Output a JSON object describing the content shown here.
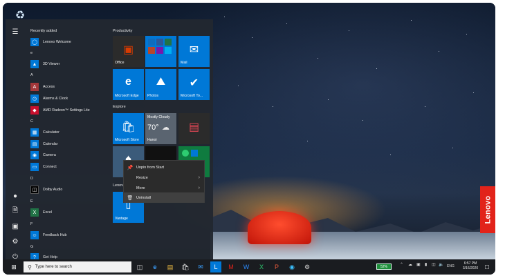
{
  "start_menu": {
    "recently_added_header": "Recently added",
    "sections": {
      "e": "e",
      "a": "A",
      "c": "C",
      "d": "D",
      "ee": "E",
      "f": "F",
      "g": "G"
    },
    "apps": {
      "lenovo_welcome": "Lenovo Welcome",
      "viewer_3d": "3D Viewer",
      "access": "Access",
      "alarms": "Alarms & Clock",
      "amd": "AMD Radeon™ Settings Lite",
      "calculator": "Calculator",
      "calendar": "Calendar",
      "camera": "Camera",
      "connect": "Connect",
      "dolby": "Dolby Audio",
      "excel": "Excel",
      "feedback": "Feedback Hub",
      "gethelp": "Get Help"
    },
    "groups": {
      "productivity": "Productivity",
      "explore": "Explore",
      "lenovo": "Lenov"
    },
    "tiles": {
      "office": "Office",
      "mail": "Mail",
      "edge": "Microsoft Edge",
      "photos": "Photos",
      "todo": "Microsoft To...",
      "store": "Microsoft Store",
      "weather_cond": "Mostly Cloudy",
      "weather_temp": "70°",
      "weather_city": "Hanoi",
      "vantage": "Vantage"
    }
  },
  "context_menu": {
    "unpin": "Unpin from Start",
    "resize": "Resize",
    "more": "More",
    "uninstall": "Uninstall"
  },
  "taskbar": {
    "search_placeholder": "Type here to search",
    "battery": "52%",
    "language": "ENG",
    "time": "6:57 PM",
    "date": "3/16/2020"
  },
  "brand": {
    "lenovo": "Lenovo"
  },
  "colors": {
    "tile_blue": "#0078d7",
    "lenovo_red": "#e2231a",
    "office_red": "#d83b01"
  }
}
